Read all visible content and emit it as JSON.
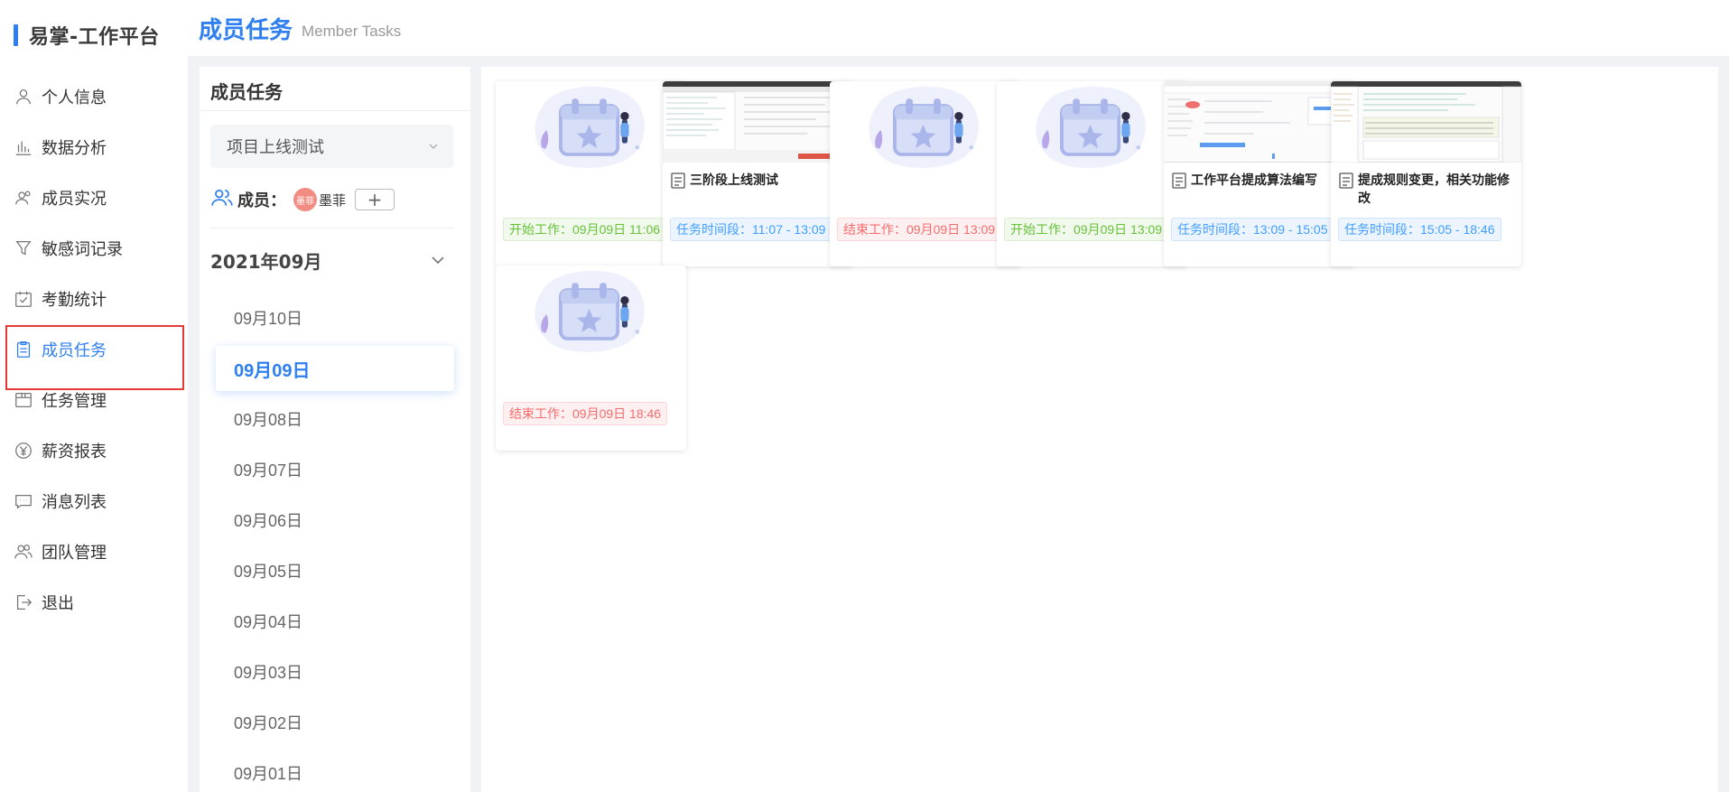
{
  "brand": {
    "title": "易掌-工作平台"
  },
  "sidebar": {
    "items": [
      {
        "label": "个人信息",
        "icon": "user-icon"
      },
      {
        "label": "数据分析",
        "icon": "bar-chart-icon"
      },
      {
        "label": "成员实况",
        "icon": "users-icon"
      },
      {
        "label": "敏感词记录",
        "icon": "filter-icon"
      },
      {
        "label": "考勤统计",
        "icon": "calendar-check-icon"
      },
      {
        "label": "成员任务",
        "icon": "clipboard-icon",
        "active": true
      },
      {
        "label": "任务管理",
        "icon": "box-icon"
      },
      {
        "label": "薪资报表",
        "icon": "yen-icon"
      },
      {
        "label": "消息列表",
        "icon": "message-icon"
      },
      {
        "label": "团队管理",
        "icon": "team-icon"
      },
      {
        "label": "退出",
        "icon": "logout-icon"
      }
    ]
  },
  "header": {
    "title": "成员任务",
    "subtitle": "Member Tasks"
  },
  "panel": {
    "title": "成员任务",
    "project": "项目上线测试",
    "members_label": "成员：",
    "avatar_text": "墨菲",
    "member_name": "墨菲",
    "add_label": "+",
    "month": "2021年09月",
    "days": [
      "09月10日",
      "09月09日",
      "09月08日",
      "09月07日",
      "09月06日",
      "09月05日",
      "09月04日",
      "09月03日",
      "09月02日",
      "09月01日"
    ],
    "active_day": "09月09日"
  },
  "cards": [
    {
      "type": "illustration",
      "tag": "开始工作：09月09日 11:06",
      "tag_color": "green"
    },
    {
      "type": "screenshot",
      "title": "三阶段上线测试",
      "tag": "任务时间段：11:07 - 13:09",
      "tag_color": "blue"
    },
    {
      "type": "illustration",
      "tag": "结束工作：09月09日 13:09",
      "tag_color": "red"
    },
    {
      "type": "illustration",
      "tag": "开始工作：09月09日 13:09",
      "tag_color": "green"
    },
    {
      "type": "screenshot",
      "title": "工作平台提成算法编写",
      "tag": "任务时间段：13:09 - 15:05",
      "tag_color": "blue"
    },
    {
      "type": "screenshot",
      "title": "提成规则变更，相关功能修改",
      "tag": "任务时间段：15:05 - 18:46",
      "tag_color": "blue"
    },
    {
      "type": "illustration",
      "tag": "结束工作：09月09日 18:46",
      "tag_color": "red"
    }
  ]
}
